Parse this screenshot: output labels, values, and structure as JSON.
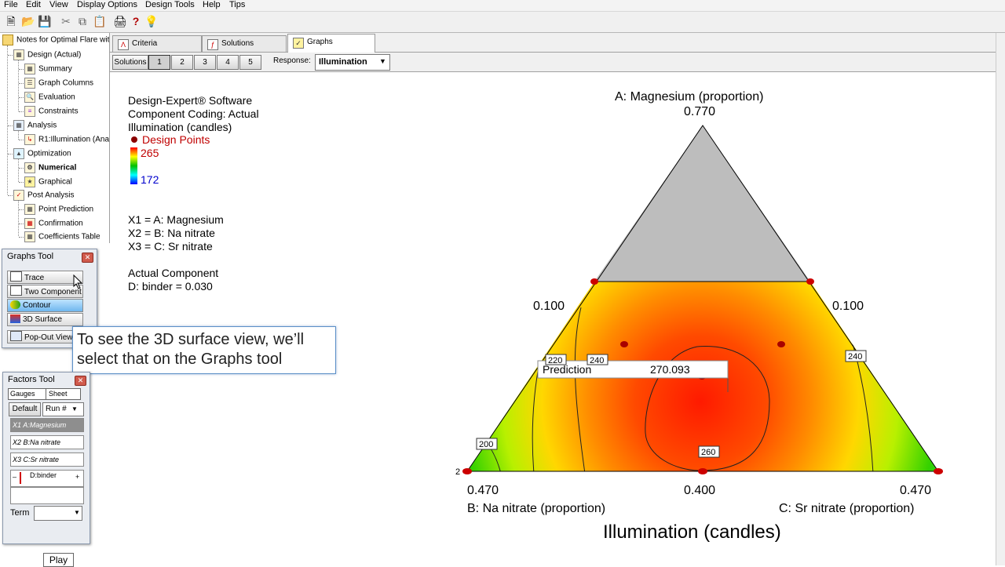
{
  "menu": [
    "File",
    "Edit",
    "View",
    "Display Options",
    "Design Tools",
    "Help",
    "Tips"
  ],
  "tree": {
    "root": "Notes for Optimal Flare wit",
    "items": [
      {
        "label": "Design (Actual)",
        "bold": false
      },
      {
        "label": "Summary",
        "bold": false
      },
      {
        "label": "Graph Columns",
        "bold": false
      },
      {
        "label": "Evaluation",
        "bold": false
      },
      {
        "label": "Constraints",
        "bold": false
      },
      {
        "label": "Analysis",
        "bold": false
      },
      {
        "label": "R1:Illumination (Anal",
        "bold": false
      },
      {
        "label": "Optimization",
        "bold": false
      },
      {
        "label": "Numerical",
        "bold": true
      },
      {
        "label": "Graphical",
        "bold": false
      },
      {
        "label": "Post Analysis",
        "bold": false
      },
      {
        "label": "Point Prediction",
        "bold": false
      },
      {
        "label": "Confirmation",
        "bold": false
      },
      {
        "label": "Coefficients Table",
        "bold": false
      }
    ]
  },
  "graphs_tool": {
    "title": "Graphs Tool",
    "buttons": [
      "Trace",
      "Two Component",
      "Contour",
      "3D Surface",
      "Pop-Out View"
    ]
  },
  "callout": "To see the 3D surface view, we’ll\nselect that on the Graphs tool",
  "factors_tool": {
    "title": "Factors Tool",
    "gauges": "Gauges",
    "sheet": "Sheet",
    "default": "Default",
    "run": "Run #",
    "factors": [
      {
        "code": "X1",
        "name": "A:Magnesium"
      },
      {
        "code": "X2",
        "name": "B:Na nitrate"
      },
      {
        "code": "X3",
        "name": "C:Sr nitrate"
      }
    ],
    "binder": "D:binder",
    "term": "Term"
  },
  "play": "Play",
  "tabs": [
    "Criteria",
    "Solutions",
    "Graphs"
  ],
  "solutions": {
    "label": "Solutions",
    "numbers": [
      "1",
      "2",
      "3",
      "4",
      "5"
    ],
    "response_label": "Response:",
    "response_value": "Illumination"
  },
  "info": {
    "line1": "Design-Expert® Software",
    "line2": "Component Coding: Actual",
    "line3": "Illumination (candles)",
    "design_points": "Design Points",
    "high": "265",
    "low": "172",
    "x1": "X1 = A: Magnesium",
    "x2": "X2 = B: Na nitrate",
    "x3": "X3 = C: Sr nitrate",
    "actual_title": "Actual Component",
    "actual_value": "D: binder = 0.030"
  },
  "chart_data": {
    "type": "ternary-contour",
    "title": "Illumination (candles)",
    "axis_a": "A: Magnesium (proportion)",
    "axis_b": "B: Na nitrate (proportion)",
    "axis_c": "C: Sr nitrate (proportion)",
    "a_top": "0.770",
    "a_left_mid": "0.100",
    "a_right_mid": "0.100",
    "b_corner": "0.470",
    "bottom_mid": "0.400",
    "c_corner": "0.470",
    "contour_labels": [
      "220",
      "240",
      "240",
      "200",
      "260"
    ],
    "replicate_label": "2",
    "prediction_label": "Prediction",
    "prediction_value": "270.093",
    "color_scale": {
      "low": 172,
      "high": 265,
      "low_color": "#0000ff",
      "high_color": "#ff0000"
    }
  }
}
